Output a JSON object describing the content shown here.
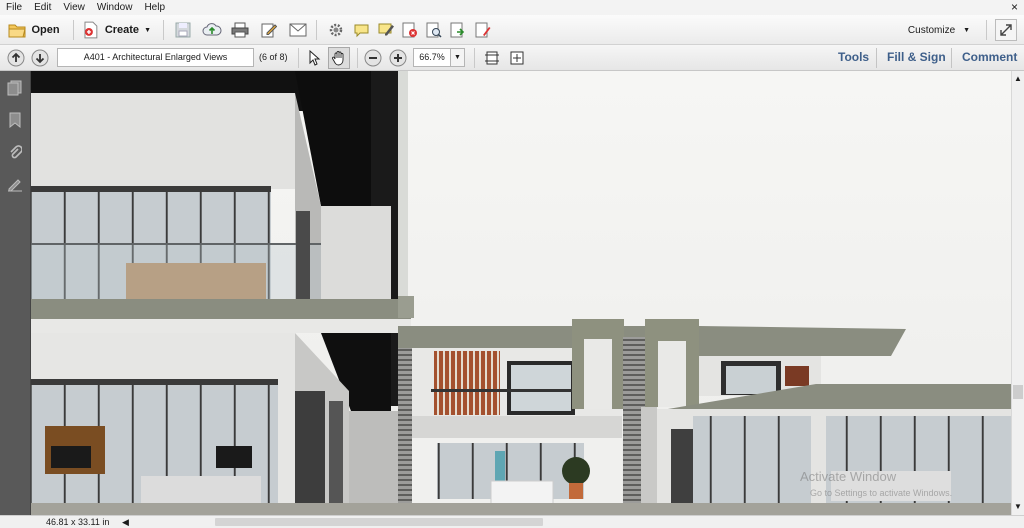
{
  "menu": {
    "items": [
      "File",
      "Edit",
      "View",
      "Window",
      "Help"
    ],
    "close_glyph": "×"
  },
  "toolbar": {
    "open_label": "Open",
    "create_label": "Create",
    "customize_label": "Customize"
  },
  "nav": {
    "doc_title": "A401 - Architectural Enlarged Views",
    "page_indicator": "(6 of 8)",
    "zoom_value": "66.7%"
  },
  "right_links": {
    "tools": "Tools",
    "fill_sign": "Fill & Sign",
    "comment": "Comment"
  },
  "status": {
    "page_size": "46.81 x 33.11 in"
  },
  "watermark": {
    "line1": "Activate Window",
    "line2": "Go to Settings to activate Windows."
  },
  "colors": {
    "link_blue": "#3e5f8a",
    "panel_dark": "#595959"
  }
}
